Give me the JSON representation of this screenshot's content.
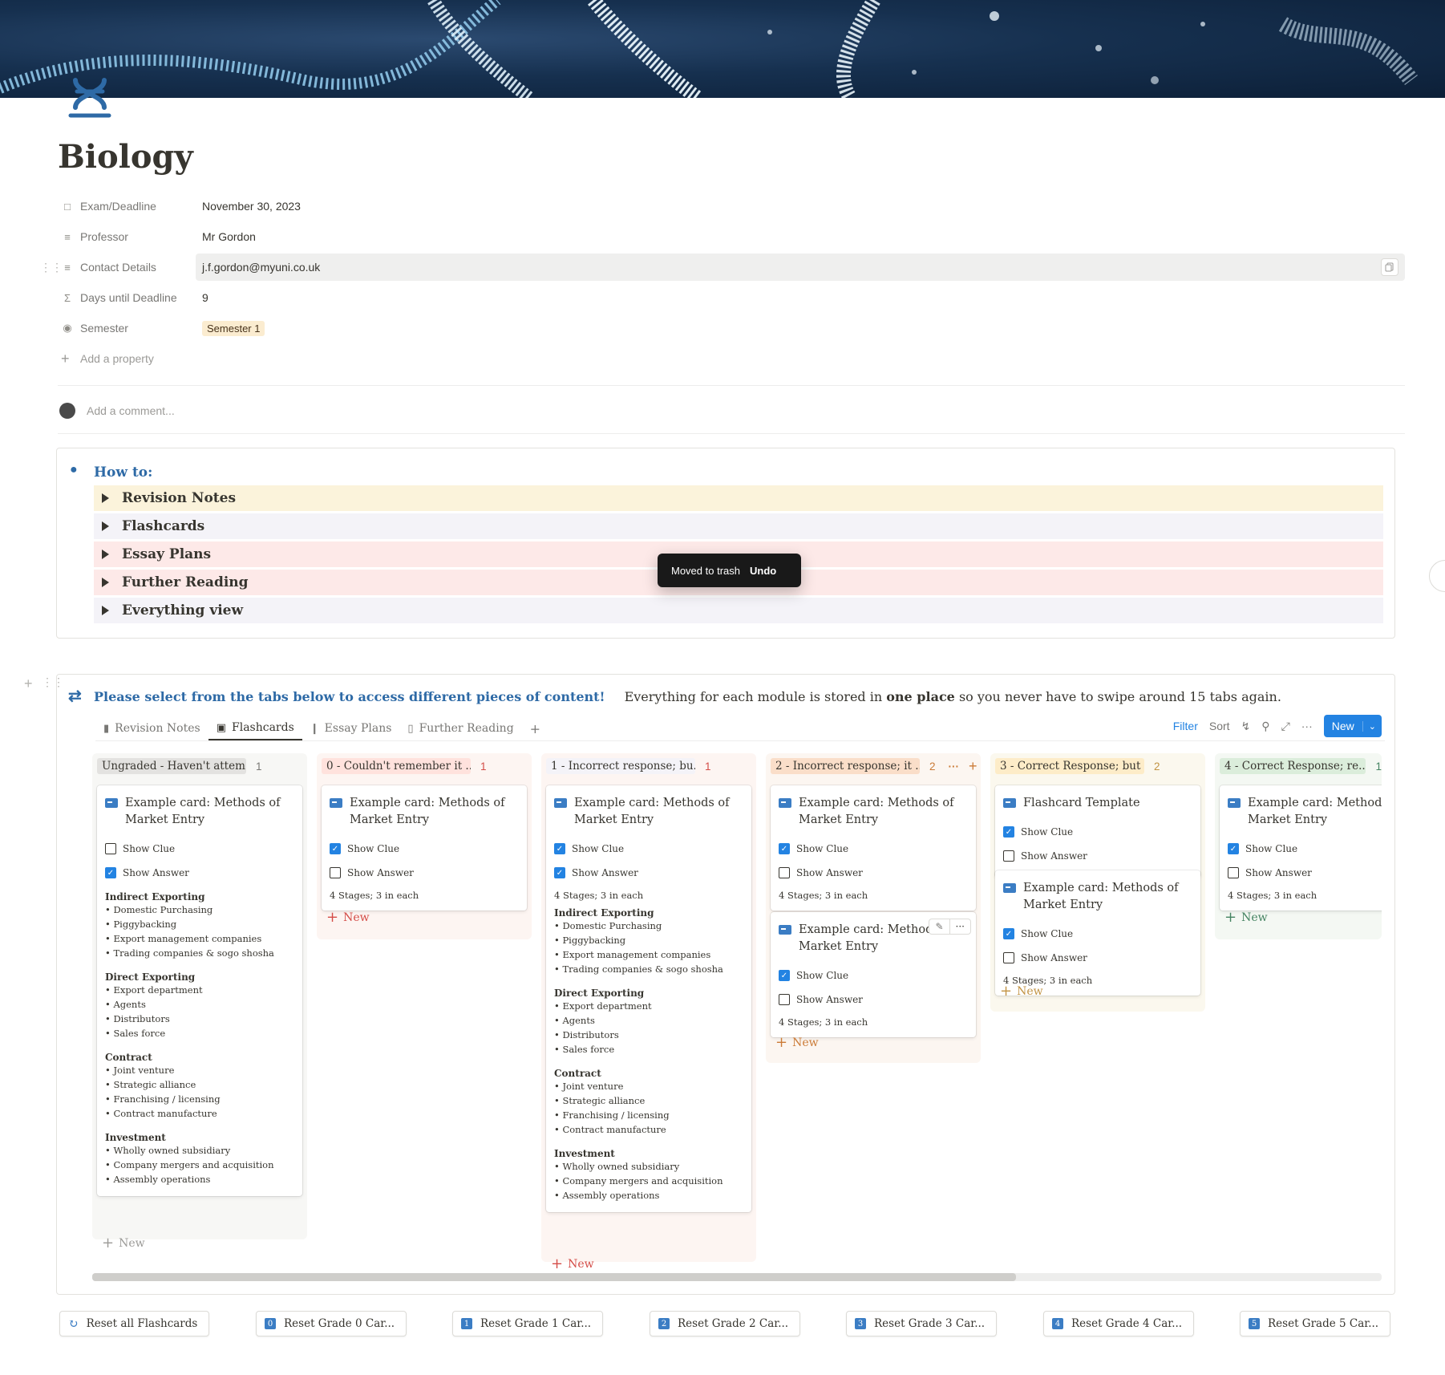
{
  "page": {
    "title": "Biology",
    "page_icon": "dna-icon",
    "cover": "dna-cover-image"
  },
  "properties": [
    {
      "label": "Exam/Deadline",
      "icon": "calendar-icon",
      "value": "November 30, 2023"
    },
    {
      "label": "Professor",
      "icon": "text-lines-icon",
      "value": "Mr Gordon"
    },
    {
      "label": "Contact Details",
      "icon": "text-lines-icon",
      "value": "j.f.gordon@myuni.co.uk"
    },
    {
      "label": "Days until Deadline",
      "icon": "sigma-icon",
      "value": "9"
    },
    {
      "label": "Semester",
      "icon": "select-icon",
      "value": "Semester 1"
    }
  ],
  "add_property": "Add a property",
  "comment_placeholder": "Add a comment...",
  "howto": {
    "title": "How to:",
    "items": [
      {
        "label": "Revision Notes",
        "bg": "#fbf3db"
      },
      {
        "label": "Flashcards",
        "bg": "#f4f3f8"
      },
      {
        "label": "Essay Plans",
        "bg": "#fde9e8"
      },
      {
        "label": "Further Reading",
        "bg": "#fde9e8"
      },
      {
        "label": "Everything view",
        "bg": "#f4f3f8"
      }
    ]
  },
  "toast": {
    "message": "Moved to trash",
    "action": "Undo"
  },
  "board": {
    "heading": "Please select from the tabs below to access different pieces of content!",
    "sub_pre": "Everything for each module is stored in ",
    "sub_bold": "one place",
    "sub_post": " so you never have to swipe around 15 tabs again.",
    "tabs": [
      {
        "label": "Revision Notes",
        "icon": "document-icon"
      },
      {
        "label": "Flashcards",
        "icon": "card-icon"
      },
      {
        "label": "Essay Plans",
        "icon": "pin-icon"
      },
      {
        "label": "Further Reading",
        "icon": "book-icon"
      }
    ],
    "toolbar": {
      "filter": "Filter",
      "sort": "Sort",
      "new": "New"
    },
    "new_label": "New",
    "columns": [
      {
        "title": "Ungraded - Haven't attem...",
        "count": "1",
        "pill_bg": "#e3e2e0",
        "col_bg": "#f7f7f5",
        "count_color": "#787774",
        "new_color": "#9b9a97"
      },
      {
        "title": "0 - Couldn't remember it ...",
        "count": "1",
        "pill_bg": "#ffe2dd",
        "col_bg": "#fdf5f2",
        "count_color": "#d44c47",
        "new_color": "#d44c47"
      },
      {
        "title": "1 - Incorrect response; bu...",
        "count": "1",
        "pill_bg": "#f4f3f8",
        "col_bg": "#fdf5f2",
        "count_color": "#d44c47",
        "new_color": "#d44c47"
      },
      {
        "title": "2 - Incorrect response; it ...",
        "count": "2",
        "pill_bg": "#fadec9",
        "col_bg": "#fcf6f1",
        "count_color": "#cb7b37",
        "new_color": "#cb7b37"
      },
      {
        "title": "3 - Correct Response; but ...",
        "count": "2",
        "pill_bg": "#fdecc8",
        "col_bg": "#fbf8ee",
        "count_color": "#c29343",
        "new_color": "#c29343"
      },
      {
        "title": "4 - Correct Response; re...",
        "count": "1",
        "pill_bg": "#dbeddb",
        "col_bg": "#f4f8f3",
        "count_color": "#448361",
        "new_color": "#448361"
      }
    ],
    "cards": {
      "example_title": "Example card: Methods of Market Entry",
      "template_title": "Flashcard Template",
      "show_clue": "Show Clue",
      "show_answer": "Show Answer",
      "stages": "4 Stages; 3 in each",
      "sections": [
        {
          "heading": "Indirect Exporting",
          "items": [
            "Domestic Purchasing",
            "Piggybacking",
            "Export management companies",
            "Trading companies & sogo shosha"
          ]
        },
        {
          "heading": "Direct Exporting",
          "items": [
            "Export department",
            "Agents",
            "Distributors",
            "Sales force"
          ]
        },
        {
          "heading": "Contract",
          "items": [
            "Joint venture",
            "Strategic alliance",
            "Franchising / licensing",
            "Contract manufacture"
          ]
        },
        {
          "heading": "Investment",
          "items": [
            "Wholly owned subsidiary",
            "Company mergers and acquisition",
            "Assembly operations"
          ]
        }
      ]
    }
  },
  "reset_buttons": [
    {
      "label": "Reset all Flashcards",
      "num": ""
    },
    {
      "label": "Reset Grade 0 Car...",
      "num": "0"
    },
    {
      "label": "Reset Grade 1 Car...",
      "num": "1"
    },
    {
      "label": "Reset Grade 2 Car...",
      "num": "2"
    },
    {
      "label": "Reset Grade 3 Car...",
      "num": "3"
    },
    {
      "label": "Reset Grade 4 Car...",
      "num": "4"
    },
    {
      "label": "Reset Grade 5 Car...",
      "num": "5"
    }
  ],
  "colors": {
    "accent": "#2383e2",
    "heading_blue": "#2e6aa6",
    "text": "#37352f"
  }
}
